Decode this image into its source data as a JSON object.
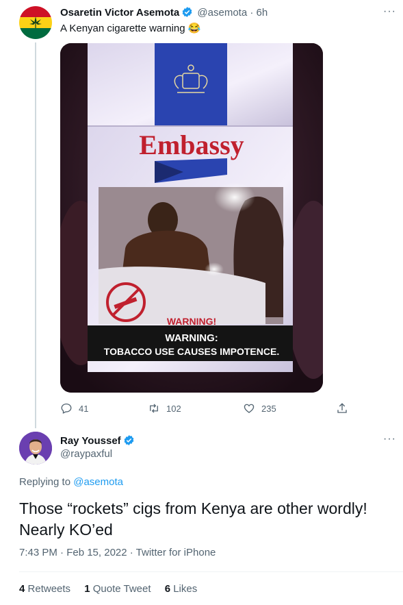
{
  "tweet1": {
    "author_name": "Osaretin Victor Asemota",
    "handle": "@asemota",
    "separator": "·",
    "time": "6h",
    "text": "A Kenyan cigarette warning 😂",
    "photo": {
      "brand": "Embassy",
      "warning_small": "WARNING!",
      "warning_line1": "WARNING:",
      "warning_line2": "TOBACCO USE CAUSES IMPOTENCE."
    },
    "actions": {
      "replies": "41",
      "retweets": "102",
      "likes": "235"
    }
  },
  "tweet2": {
    "author_name": "Ray Youssef",
    "handle": "@raypaxful",
    "replying_prefix": "Replying to",
    "replying_handle": "@asemota",
    "text": "Those “rockets” cigs from Kenya are other wordly! Nearly KO’ed",
    "timestamp": "7:43 PM · Feb 15, 2022 · Twitter for iPhone",
    "stats": {
      "retweets_count": "4",
      "retweets_label": "Retweets",
      "quotes_count": "1",
      "quotes_label": "Quote Tweet",
      "likes_count": "6",
      "likes_label": "Likes"
    }
  },
  "more_glyph": "···",
  "colors": {
    "accent": "#1d9bf0",
    "muted": "#536471",
    "embassy_red": "#c0202e",
    "pack_blue": "#2a44b0"
  }
}
